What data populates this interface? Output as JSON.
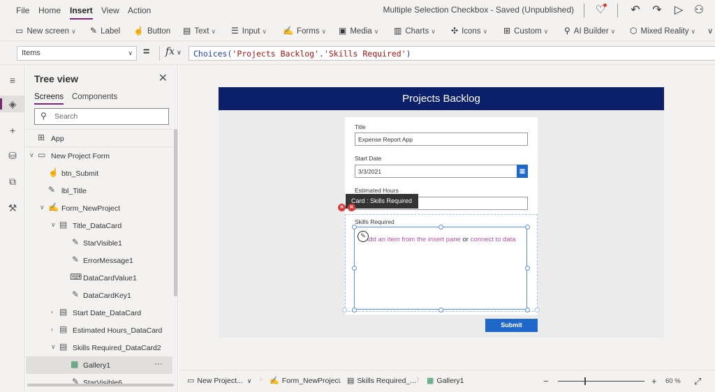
{
  "menu": {
    "items": [
      "File",
      "Home",
      "Insert",
      "View",
      "Action"
    ],
    "active": "Insert"
  },
  "app_title": "Multiple Selection Checkbox - Saved (Unpublished)",
  "ribbon": {
    "new_screen": "New screen",
    "label": "Label",
    "button": "Button",
    "text": "Text",
    "input": "Input",
    "forms": "Forms",
    "media": "Media",
    "charts": "Charts",
    "icons": "Icons",
    "custom": "Custom",
    "ai_builder": "AI Builder",
    "mixed_reality": "Mixed Reality"
  },
  "formula_bar": {
    "property": "Items",
    "equals": "=",
    "fx": "fx",
    "formula_prefix": "Choices(",
    "formula_str1": "'Projects Backlog'",
    "formula_dot": ".",
    "formula_str2": "'Skills Required'",
    "formula_suffix": ")"
  },
  "tree": {
    "title": "Tree view",
    "tabs": [
      "Screens",
      "Components"
    ],
    "search_placeholder": "Search",
    "app": "App",
    "items": [
      {
        "label": "New Project Form"
      },
      {
        "label": "btn_Submit"
      },
      {
        "label": "lbl_Title"
      },
      {
        "label": "Form_NewProject"
      },
      {
        "label": "Title_DataCard"
      },
      {
        "label": "StarVisible1"
      },
      {
        "label": "ErrorMessage1"
      },
      {
        "label": "DataCardValue1"
      },
      {
        "label": "DataCardKey1"
      },
      {
        "label": "Start Date_DataCard"
      },
      {
        "label": "Estimated Hours_DataCard"
      },
      {
        "label": "Skills Required_DataCard2"
      },
      {
        "label": "Gallery1"
      },
      {
        "label": "StarVisible6"
      }
    ],
    "more": "···"
  },
  "canvas": {
    "header": "Projects Backlog",
    "title_label": "Title",
    "title_value": "Expense Report App",
    "start_date_label": "Start Date",
    "start_date_value": "3/3/2021",
    "estimated_hours_label": "Estimated Hours",
    "tooltip": "Card : Skills Required",
    "skills_label": "Skills Required",
    "gallery_msg_a": "Add an item from the insert pane",
    "gallery_msg_or": " or ",
    "gallery_msg_b": "connect to data",
    "submit": "Submit"
  },
  "bottom": {
    "crumbs": [
      "New Project...",
      "Form_NewProject",
      "Skills Required_...",
      "Gallery1"
    ],
    "zoom_minus": "−",
    "zoom_plus": "+",
    "zoom_value": "60",
    "zoom_unit": "%"
  },
  "colors": {
    "accent": "#742774",
    "header": "#0c1f6b",
    "button": "#1f67c8",
    "link": "#b252a7",
    "error": "#d83b3b"
  }
}
